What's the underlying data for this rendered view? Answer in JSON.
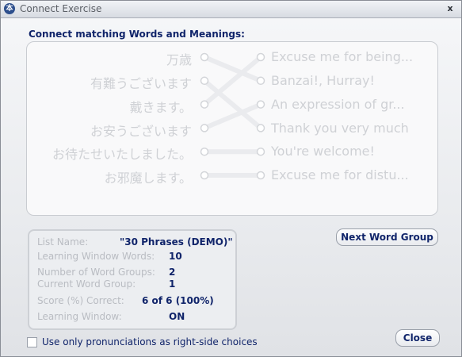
{
  "window": {
    "title": "Connect Exercise",
    "close_label": "x",
    "icon_glyph": "本"
  },
  "instruction": "Connect matching Words and Meanings:",
  "words": [
    "万歳",
    "有難うございます",
    "戴きます。",
    "お安うございます",
    "お待たせいたしました。",
    "お邪魔します。"
  ],
  "meanings": [
    "Excuse me for being...",
    "Banzai!, Hurray!",
    "An expression of gr...",
    "Thank you very much",
    "You're welcome!",
    "Excuse me for distu..."
  ],
  "connections": [
    [
      0,
      1
    ],
    [
      1,
      3
    ],
    [
      2,
      0
    ],
    [
      3,
      2
    ],
    [
      4,
      4
    ],
    [
      5,
      5
    ]
  ],
  "info": {
    "list_name_label": "List Name:",
    "list_name_value": "\"30 Phrases (DEMO)\"",
    "learning_window_words_label": "Learning Window Words:",
    "learning_window_words_value": "10",
    "number_of_word_groups_label": "Number of Word Groups:",
    "number_of_word_groups_value": "2",
    "current_word_group_label": "Current Word Group:",
    "current_word_group_value": "1",
    "score_label": "Score (%) Correct:",
    "score_value": "6 of 6 (100%)",
    "learning_window_label": "Learning Window:",
    "learning_window_value": "ON"
  },
  "buttons": {
    "next_word_group": "Next Word Group",
    "close": "Close"
  },
  "option": {
    "label": "Use only pronunciations as right-side choices",
    "checked": false
  },
  "colors": {
    "label_blue": "#10246a",
    "faded_text": "#cfd1d5",
    "line": "#eaebee"
  }
}
